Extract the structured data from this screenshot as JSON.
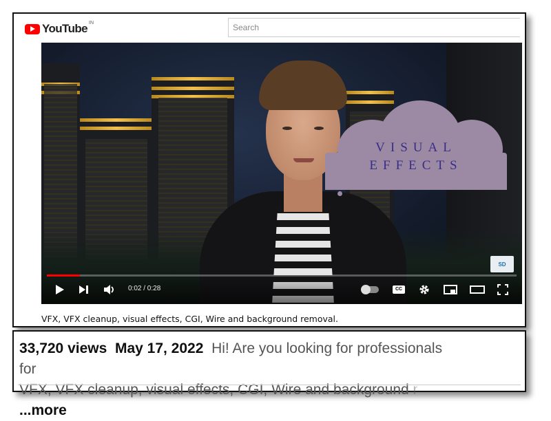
{
  "header": {
    "logo_text": "YouTube",
    "country_code": "IN",
    "search_placeholder": "Search"
  },
  "video": {
    "overlay_line1": "VISUAL",
    "overlay_line2": "EFFECTS",
    "current_time": "0:02",
    "duration": "0:28",
    "time_display": "0:02 / 0:28",
    "progress_fraction": 0.071,
    "cc_label": "CC",
    "watermark_text": "SD"
  },
  "caption": "VFX, VFX cleanup, visual effects, CGI, Wire and background removal.",
  "description": {
    "views": "33,720 views",
    "date": "May 17, 2022",
    "snippet_1": "Hi! Are you looking for professionals for",
    "snippet_2": "VFX, VFX cleanup, visual effects, CGI, Wire and background",
    "snippet_fade": " r",
    "more_label": "...more"
  },
  "colors": {
    "brand_red": "#ff0000",
    "cloud": "#9c8aa4",
    "overlay_text": "#3a2d86"
  }
}
